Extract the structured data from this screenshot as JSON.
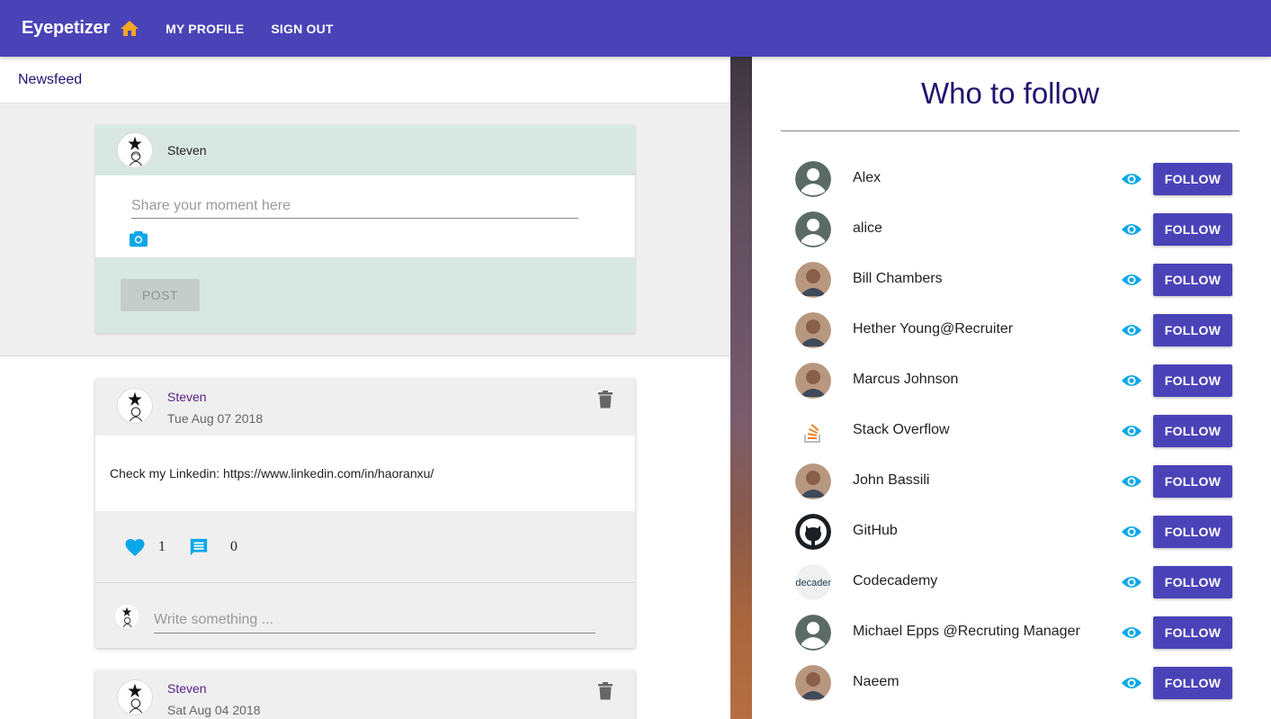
{
  "appbar": {
    "brand": "Eyepetizer",
    "nav": [
      "MY PROFILE",
      "SIGN OUT"
    ],
    "home_icon": "home-icon",
    "accent": "#4a43b8",
    "home_color": "#f5a623"
  },
  "newsfeed": {
    "title": "Newsfeed",
    "composer": {
      "user": "Steven",
      "placeholder": "Share your moment here",
      "post_label": "POST"
    },
    "posts": [
      {
        "author": "Steven",
        "date": "Tue Aug 07 2018",
        "text": "Check my Linkedin: https://www.linkedin.com/in/haoranxu/",
        "likes": "1",
        "comments": "0",
        "comment_placeholder": "Write something ..."
      },
      {
        "author": "Steven",
        "date": "Sat Aug 04 2018"
      }
    ]
  },
  "who_to_follow": {
    "title": "Who to follow",
    "follow_label": "FOLLOW",
    "users": [
      {
        "name": "Alex",
        "avatar": "default-person"
      },
      {
        "name": "alice",
        "avatar": "default-person"
      },
      {
        "name": "Bill Chambers",
        "avatar": "photo"
      },
      {
        "name": "Hether Young@Recruiter",
        "avatar": "photo"
      },
      {
        "name": "Marcus Johnson",
        "avatar": "photo"
      },
      {
        "name": "Stack Overflow",
        "avatar": "stackoverflow-logo"
      },
      {
        "name": "John Bassili",
        "avatar": "photo"
      },
      {
        "name": "GitHub",
        "avatar": "github-logo"
      },
      {
        "name": "Codecademy",
        "avatar": "codecademy-logo",
        "logo_text": "odecadem"
      },
      {
        "name": "Michael Epps @Recruting Manager",
        "avatar": "default-person"
      },
      {
        "name": "Naeem",
        "avatar": "photo"
      }
    ]
  }
}
